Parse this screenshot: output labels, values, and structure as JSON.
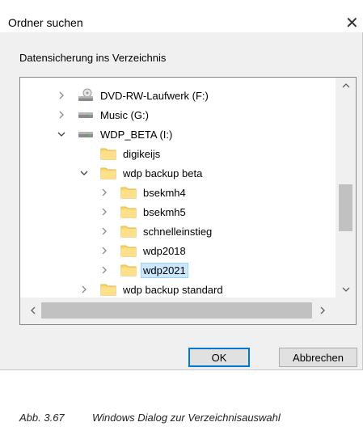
{
  "dialog": {
    "title": "Ordner suchen",
    "close_glyph": "✕",
    "prompt": "Datensicherung ins Verzeichnis",
    "tree": {
      "nodes": [
        {
          "label": "DVD-RW-Laufwerk (F:)",
          "icon": "dvd-drive-icon",
          "chevron": "right",
          "selected": false
        },
        {
          "label": "Music (G:)",
          "icon": "drive-icon",
          "chevron": "right",
          "selected": false
        },
        {
          "label": "WDP_BETA (I:)",
          "icon": "drive-icon",
          "chevron": "down",
          "selected": false
        },
        {
          "label": "digikeijs",
          "icon": "folder-icon",
          "chevron": "none",
          "selected": false
        },
        {
          "label": "wdp backup beta",
          "icon": "folder-icon",
          "chevron": "down",
          "selected": false
        },
        {
          "label": "bsekmh4",
          "icon": "folder-icon",
          "chevron": "right",
          "selected": false
        },
        {
          "label": "bsekmh5",
          "icon": "folder-icon",
          "chevron": "right",
          "selected": false
        },
        {
          "label": "schnelleinstieg",
          "icon": "folder-icon",
          "chevron": "right",
          "selected": false
        },
        {
          "label": "wdp2018",
          "icon": "folder-icon",
          "chevron": "right",
          "selected": false
        },
        {
          "label": "wdp2021",
          "icon": "folder-icon",
          "chevron": "right",
          "selected": true
        },
        {
          "label": "wdp backup standard",
          "icon": "folder-icon",
          "chevron": "right",
          "selected": false
        }
      ]
    },
    "buttons": {
      "ok": "OK",
      "cancel": "Abbrechen"
    },
    "colors": {
      "selection": "#cce8ff",
      "selection_border": "#99d1ff",
      "folder": "#ffd76e",
      "default_button_border": "#0078d7"
    }
  },
  "caption": {
    "number": "Abb. 3.67",
    "text": "Windows Dialog zur Verzeichnisauswahl"
  }
}
